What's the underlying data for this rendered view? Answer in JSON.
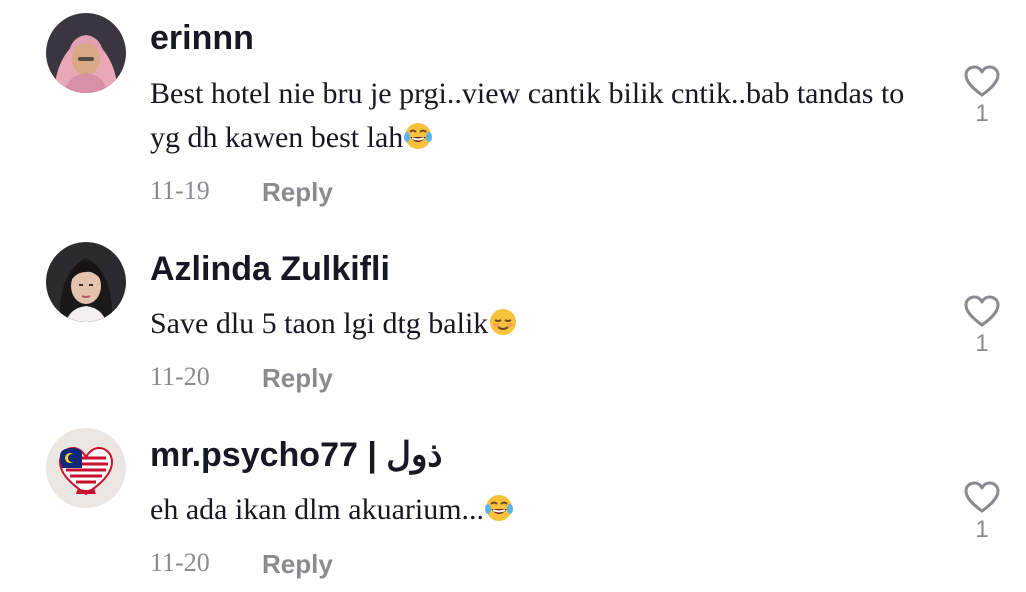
{
  "comments": [
    {
      "username": "erinnn",
      "text": "Best hotel nie bru je prgi..view cantik bilik cntik..bab tandas to yg dh kawen best lah",
      "emoji": "face-with-tears-of-joy",
      "date": "11-19",
      "reply_label": "Reply",
      "like_count": "1"
    },
    {
      "username": "Azlinda Zulkifli",
      "text": "Save dlu 5 taon lgi dtg balik",
      "emoji": "relieved-face",
      "date": "11-20",
      "reply_label": "Reply",
      "like_count": "1"
    },
    {
      "username": "mr.psycho77 | ذول",
      "text": "eh ada ikan dlm akuarium...",
      "emoji": "face-with-tears-of-joy",
      "date": "11-20",
      "reply_label": "Reply",
      "like_count": "1"
    }
  ],
  "colors": {
    "text": "#161823",
    "muted": "#8a8b91",
    "emoji_yellow": "#f9c23c",
    "tear_blue": "#5ab4f0"
  },
  "icons": {
    "like": "heart-outline-icon"
  }
}
